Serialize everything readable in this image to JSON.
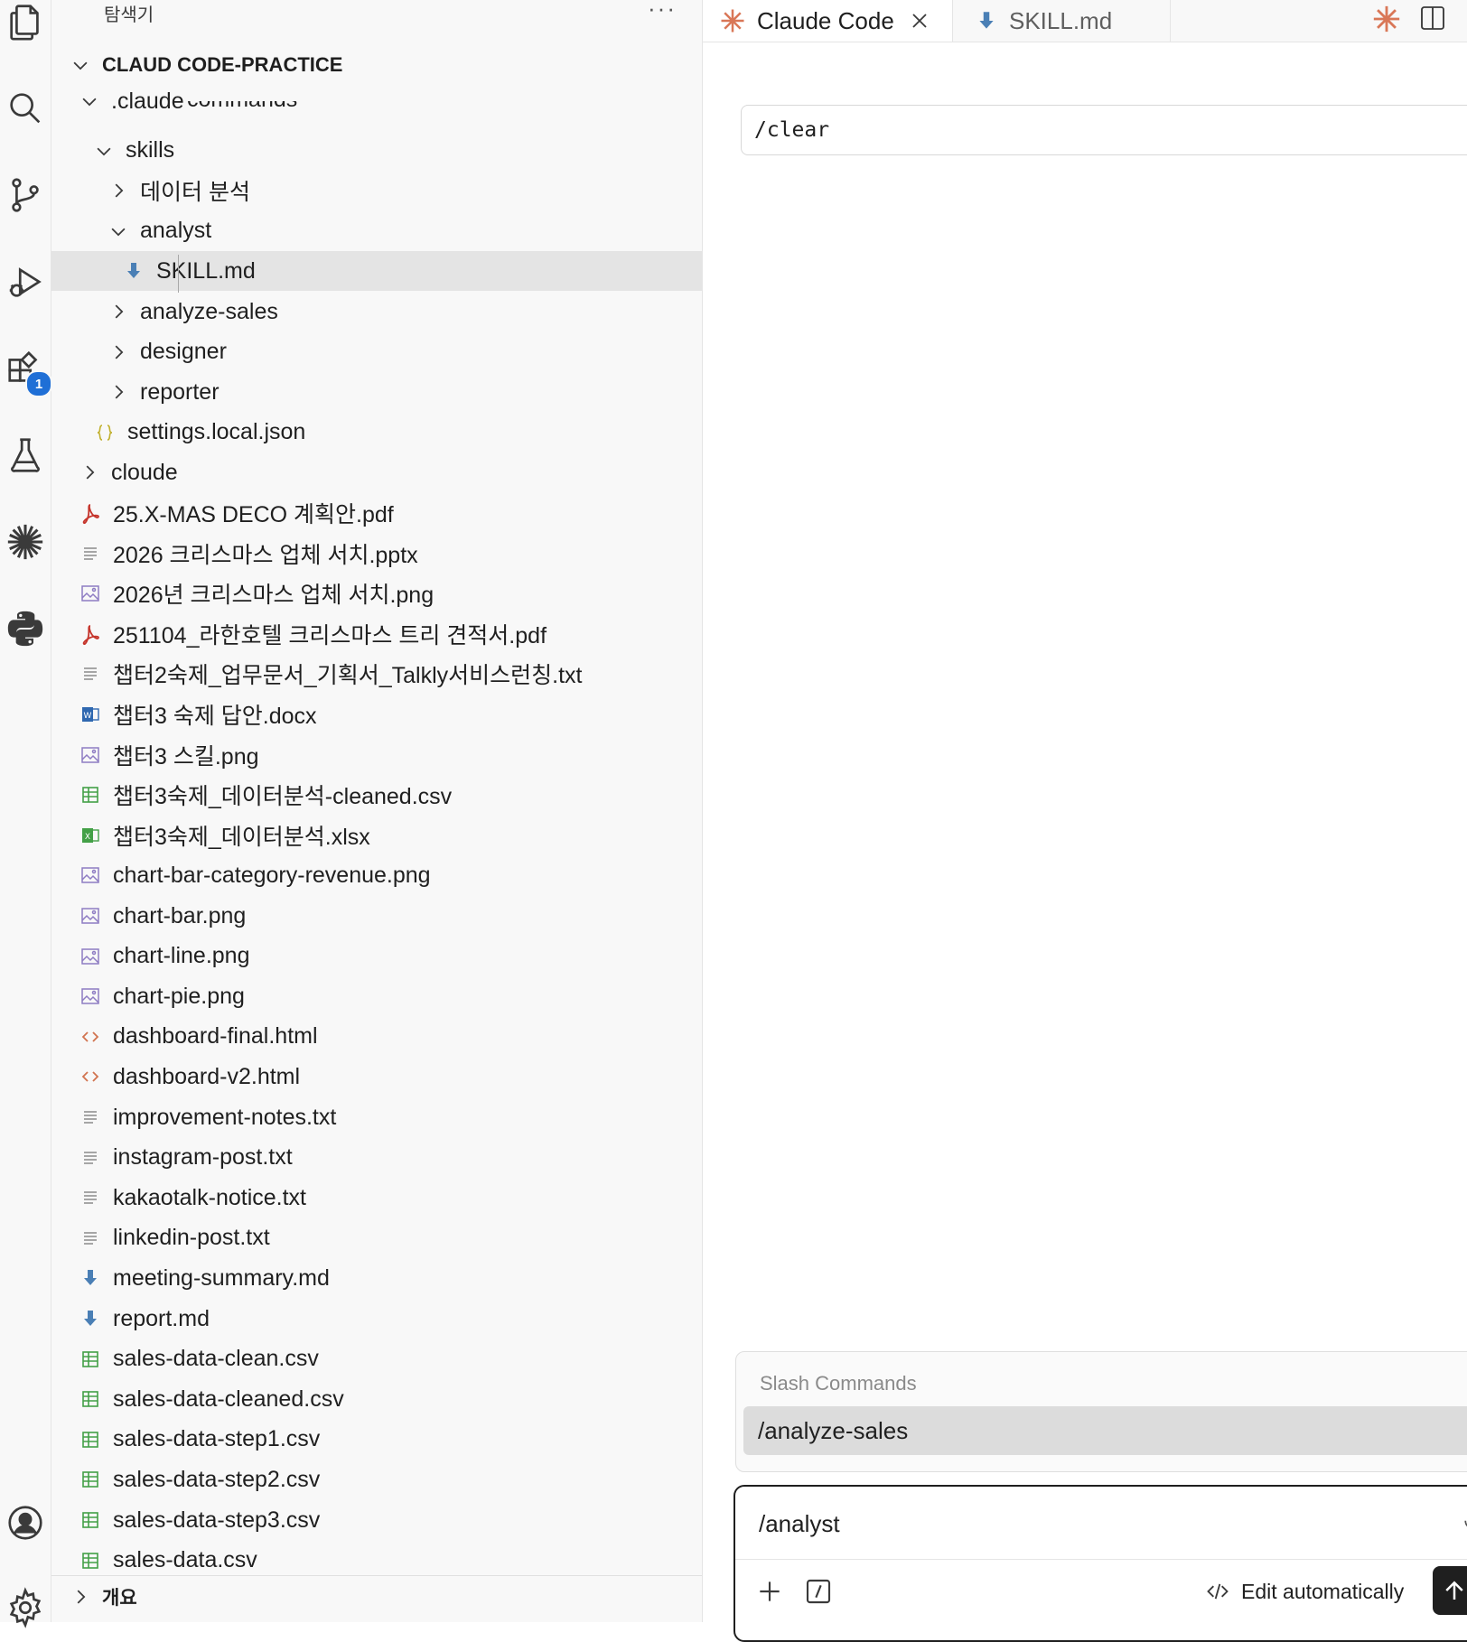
{
  "explorer": {
    "title": "탐색기",
    "more_label": "···",
    "root": "CLAUD CODE-PRACTICE",
    "clipped_folder": "commands",
    "outline_label": "개요",
    "tree": [
      {
        "label": ".claude",
        "kind": "folder-open",
        "depth": 0
      },
      {
        "label": "skills",
        "kind": "folder-open",
        "depth": 1
      },
      {
        "label": "데이터 분석",
        "kind": "folder",
        "depth": 2
      },
      {
        "label": "analyst",
        "kind": "folder-open",
        "depth": 2
      },
      {
        "label": "SKILL.md",
        "kind": "md",
        "depth": 3,
        "selected": true
      },
      {
        "label": "analyze-sales",
        "kind": "folder",
        "depth": 2
      },
      {
        "label": "designer",
        "kind": "folder",
        "depth": 2
      },
      {
        "label": "reporter",
        "kind": "folder",
        "depth": 2
      },
      {
        "label": "settings.local.json",
        "kind": "json",
        "depth": 1
      },
      {
        "label": "cloude",
        "kind": "folder",
        "depth": 0
      },
      {
        "label": "25.X-MAS DECO 계획안.pdf",
        "kind": "pdf",
        "depth": 0
      },
      {
        "label": "2026 크리스마스 업체 서치.pptx",
        "kind": "txt",
        "depth": 0
      },
      {
        "label": "2026년 크리스마스 업체 서치.png",
        "kind": "img",
        "depth": 0
      },
      {
        "label": "251104_라한호텔 크리스마스 트리 견적서.pdf",
        "kind": "pdf",
        "depth": 0
      },
      {
        "label": "챕터2숙제_업무문서_기획서_Talkly서비스런칭.txt",
        "kind": "txt",
        "depth": 0
      },
      {
        "label": "챕터3 숙제 답안.docx",
        "kind": "docx",
        "depth": 0
      },
      {
        "label": "챕터3 스킬.png",
        "kind": "img",
        "depth": 0
      },
      {
        "label": "챕터3숙제_데이터분석-cleaned.csv",
        "kind": "csv",
        "depth": 0
      },
      {
        "label": "챕터3숙제_데이터분석.xlsx",
        "kind": "xlsx",
        "depth": 0
      },
      {
        "label": "chart-bar-category-revenue.png",
        "kind": "img",
        "depth": 0
      },
      {
        "label": "chart-bar.png",
        "kind": "img",
        "depth": 0
      },
      {
        "label": "chart-line.png",
        "kind": "img",
        "depth": 0
      },
      {
        "label": "chart-pie.png",
        "kind": "img",
        "depth": 0
      },
      {
        "label": "dashboard-final.html",
        "kind": "html",
        "depth": 0
      },
      {
        "label": "dashboard-v2.html",
        "kind": "html",
        "depth": 0
      },
      {
        "label": "improvement-notes.txt",
        "kind": "txt",
        "depth": 0
      },
      {
        "label": "instagram-post.txt",
        "kind": "txt",
        "depth": 0
      },
      {
        "label": "kakaotalk-notice.txt",
        "kind": "txt",
        "depth": 0
      },
      {
        "label": "linkedin-post.txt",
        "kind": "txt",
        "depth": 0
      },
      {
        "label": "meeting-summary.md",
        "kind": "md",
        "depth": 0
      },
      {
        "label": "report.md",
        "kind": "md",
        "depth": 0
      },
      {
        "label": "sales-data-clean.csv",
        "kind": "csv",
        "depth": 0
      },
      {
        "label": "sales-data-cleaned.csv",
        "kind": "csv",
        "depth": 0
      },
      {
        "label": "sales-data-step1.csv",
        "kind": "csv",
        "depth": 0
      },
      {
        "label": "sales-data-step2.csv",
        "kind": "csv",
        "depth": 0
      },
      {
        "label": "sales-data-step3.csv",
        "kind": "csv",
        "depth": 0
      },
      {
        "label": "sales-data.csv",
        "kind": "csv",
        "depth": 0
      }
    ]
  },
  "activity_bar": {
    "extensions_badge": "1"
  },
  "tabs": [
    {
      "label": "Claude Code",
      "icon": "claude-spark-icon",
      "active": true
    },
    {
      "label": "SKILL.md",
      "icon": "markdown-icon",
      "active": false
    }
  ],
  "chat": {
    "sent_command": "/clear",
    "slash_title": "Slash Commands",
    "slash_item": "/analyze-sales",
    "input_value": "/analyst",
    "edit_mode": "Edit automatically"
  },
  "colors": {
    "accent_orange": "#d97757",
    "badge_blue": "#1f6fd6",
    "md_blue": "#4a7fb5",
    "pdf_red": "#c5342b",
    "csv_green": "#43a047",
    "img_purple": "#8e7cc3",
    "json_yellow": "#c2b130",
    "html_orange": "#d1734f"
  }
}
